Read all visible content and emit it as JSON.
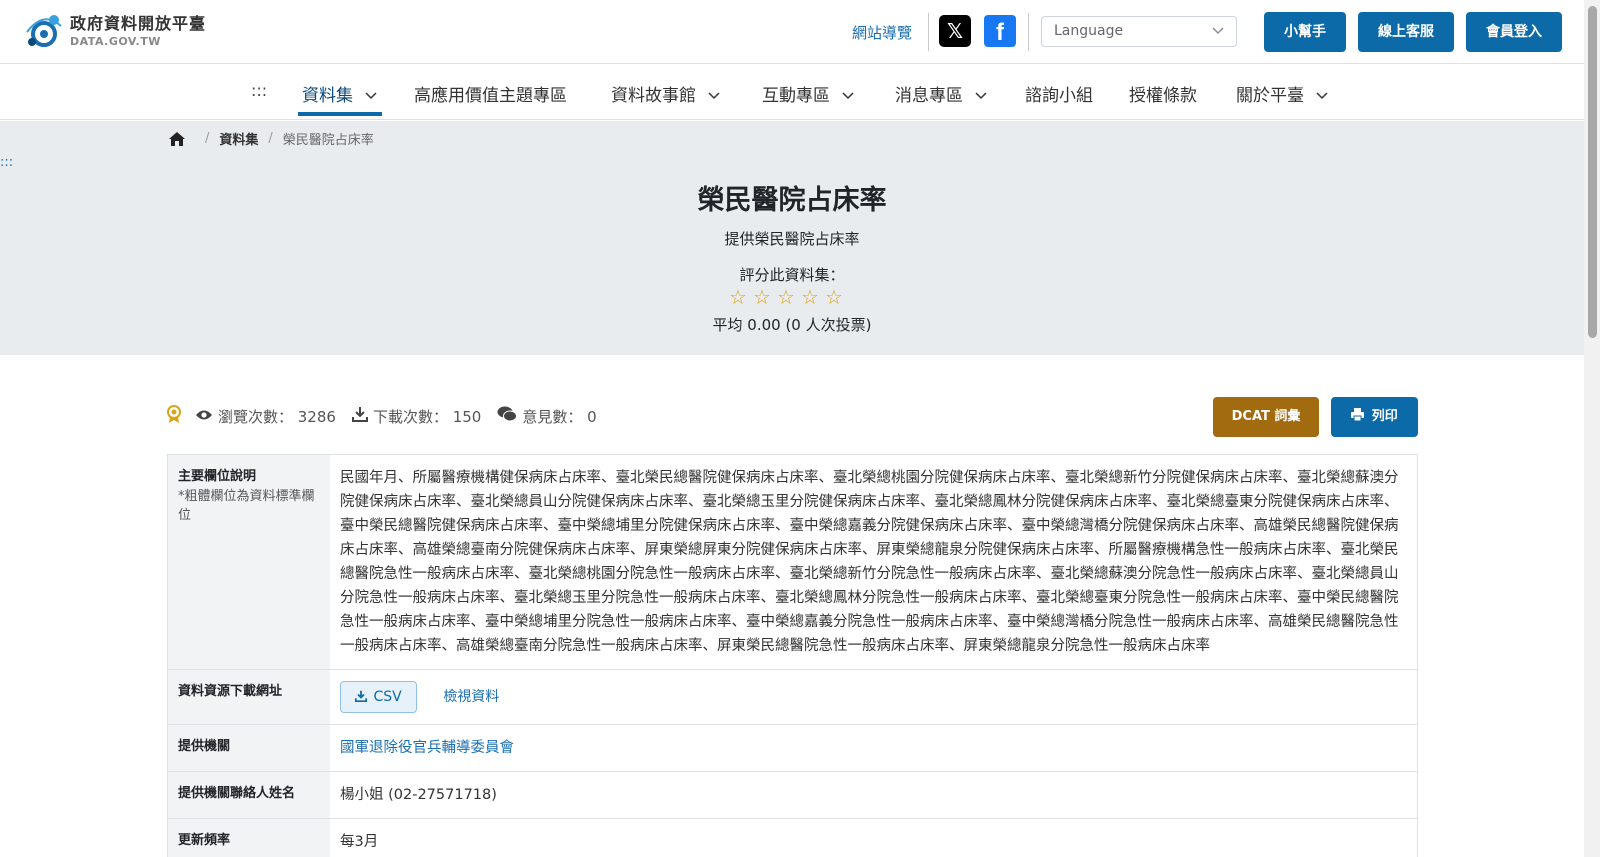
{
  "header": {
    "logo_title": "政府資料開放平臺",
    "logo_sub": "DATA.GOV.TW",
    "sitemap": "網站導覽",
    "x_icon": "x-icon",
    "facebook_icon": "facebook-icon",
    "language_placeholder": "Language",
    "helper": "小幫手",
    "service": "線上客服",
    "login": "會員登入"
  },
  "nav": {
    "skip": ":::",
    "items": [
      {
        "label": "資料集",
        "dropdown": true,
        "active": true
      },
      {
        "label": "高應用價值主題專區",
        "dropdown": false
      },
      {
        "label": "資料故事館",
        "dropdown": true
      },
      {
        "label": "互動專區",
        "dropdown": true
      },
      {
        "label": "消息專區",
        "dropdown": true
      },
      {
        "label": "諮詢小組",
        "dropdown": false
      },
      {
        "label": "授權條款",
        "dropdown": false
      },
      {
        "label": "關於平臺",
        "dropdown": true
      }
    ]
  },
  "breadcrumb": {
    "home_icon": "home-icon",
    "section": "資料集",
    "current": "榮民醫院占床率"
  },
  "side_skip": ":::",
  "dataset": {
    "title": "榮民醫院占床率",
    "description": "提供榮民醫院占床率",
    "rate_label": "評分此資料集：",
    "rating": 0,
    "rating_max": 5,
    "average": "平均 0.00 (0 人次投票)"
  },
  "stats": {
    "medal_icon": "medal-icon",
    "views": "瀏覽次數： 3286",
    "downloads": "下載次數： 150",
    "comments": "意見數： 0"
  },
  "actions": {
    "dcat": "DCAT 詞彙",
    "print": "列印"
  },
  "table": {
    "fields_label": "主要欄位說明",
    "fields_note": "*粗體欄位為資料標準欄位",
    "fields_value": "民國年月、所屬醫療機構健保病床占床率、臺北榮民總醫院健保病床占床率、臺北榮總桃園分院健保病床占床率、臺北榮總新竹分院健保病床占床率、臺北榮總蘇澳分院健保病床占床率、臺北榮總員山分院健保病床占床率、臺北榮總玉里分院健保病床占床率、臺北榮總鳳林分院健保病床占床率、臺北榮總臺東分院健保病床占床率、臺中榮民總醫院健保病床占床率、臺中榮總埔里分院健保病床占床率、臺中榮總嘉義分院健保病床占床率、臺中榮總灣橋分院健保病床占床率、高雄榮民總醫院健保病床占床率、高雄榮總臺南分院健保病床占床率、屏東榮總屏東分院健保病床占床率、屏東榮總龍泉分院健保病床占床率、所屬醫療機構急性一般病床占床率、臺北榮民總醫院急性一般病床占床率、臺北榮總桃園分院急性一般病床占床率、臺北榮總新竹分院急性一般病床占床率、臺北榮總蘇澳分院急性一般病床占床率、臺北榮總員山分院急性一般病床占床率、臺北榮總玉里分院急性一般病床占床率、臺北榮總鳳林分院急性一般病床占床率、臺北榮總臺東分院急性一般病床占床率、臺中榮民總醫院急性一般病床占床率、臺中榮總埔里分院急性一般病床占床率、臺中榮總嘉義分院急性一般病床占床率、臺中榮總灣橋分院急性一般病床占床率、高雄榮民總醫院急性一般病床占床率、高雄榮總臺南分院急性一般病床占床率、屏東榮民總醫院急性一般病床占床率、屏東榮總龍泉分院急性一般病床占床率",
    "download_label": "資料資源下載網址",
    "csv": "CSV",
    "view_data": "檢視資料",
    "agency_label": "提供機關",
    "agency_value": "國軍退除役官兵輔導委員會",
    "contact_label": "提供機關聯絡人姓名",
    "contact_value": "楊小姐 (02-27571718)",
    "frequency_label": "更新頻率",
    "frequency_value": "每3月"
  }
}
